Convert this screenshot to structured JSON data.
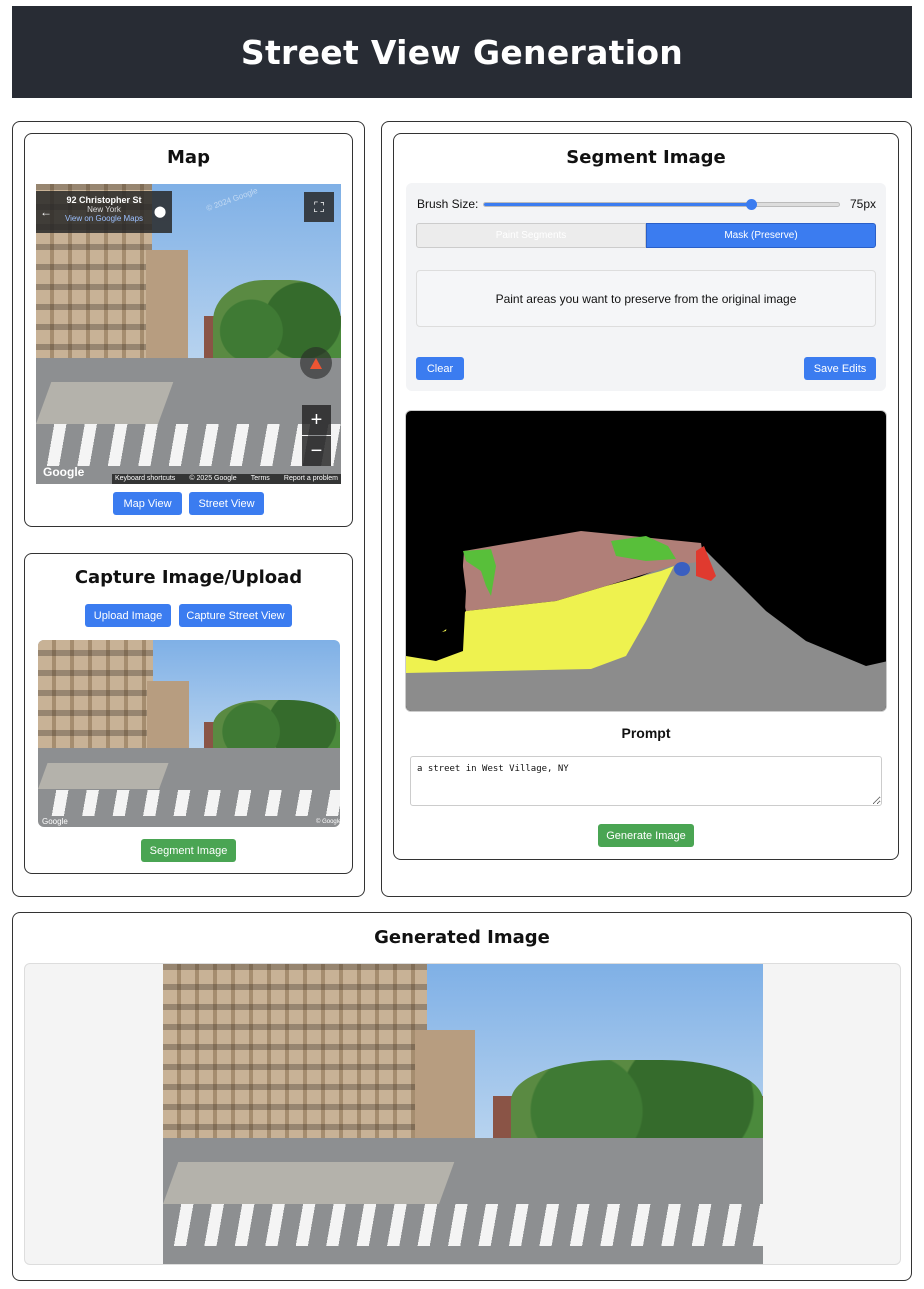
{
  "header": {
    "title": "Street View Generation"
  },
  "map": {
    "title": "Map",
    "location_name": "92 Christopher St",
    "location_city": "New York",
    "location_link": "View on Google Maps",
    "watermark": "© 2024 Google",
    "google_logo": "Google",
    "attribution": [
      "Keyboard shortcuts",
      "© 2025 Google",
      "Terms",
      "Report a problem"
    ],
    "map_view_label": "Map View",
    "street_view_label": "Street View"
  },
  "capture": {
    "title": "Capture Image/Upload",
    "upload_label": "Upload Image",
    "capture_label": "Capture Street View",
    "google_logo": "Google",
    "copyright": "© Google",
    "segment_label": "Segment Image"
  },
  "segment": {
    "title": "Segment Image",
    "brush_label": "Brush Size:",
    "brush_value": 0.75,
    "brush_value_text": "75px",
    "mode_paint": "Paint Segments",
    "mode_mask": "Mask (Preserve)",
    "hint": "Paint areas you want to preserve from the original image",
    "clear_label": "Clear",
    "save_label": "Save Edits",
    "prompt_title": "Prompt",
    "prompt_value": "a street in West Village, NY",
    "generate_label": "Generate Image",
    "colors": {
      "sky": "#000000",
      "building": "#b07f78",
      "sidewalk": "#eef24f",
      "road": "#8c8c8c",
      "vegetation": "#58bf3a",
      "car": "#e03a2f",
      "person": "#3a5fc0"
    }
  },
  "generated": {
    "title": "Generated Image"
  },
  "colors": {
    "header_bg": "#282c34",
    "accent": "#3b7cf0",
    "green": "#4aa553"
  }
}
